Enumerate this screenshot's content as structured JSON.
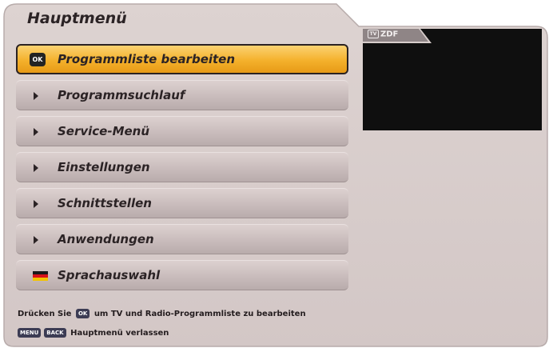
{
  "window": {
    "title": "Hauptmenü"
  },
  "menu": {
    "items": [
      {
        "label": "Programmliste bearbeiten",
        "icon": "ok-icon",
        "active": true
      },
      {
        "label": "Programmsuchlauf",
        "icon": "arrow-icon"
      },
      {
        "label": "Service-Menü",
        "icon": "arrow-icon"
      },
      {
        "label": "Einstellungen",
        "icon": "arrow-icon"
      },
      {
        "label": "Schnittstellen",
        "icon": "arrow-icon"
      },
      {
        "label": "Anwendungen",
        "icon": "arrow-icon"
      },
      {
        "label": "Sprachauswahl",
        "icon": "german-flag-icon"
      }
    ]
  },
  "ok_key_label": "OK",
  "preview": {
    "channel": "ZDF",
    "tv_icon": "TV"
  },
  "footer": {
    "hint_prefix": "Drücken Sie",
    "hint_suffix": "um TV und Radio-Programmliste zu bearbeiten",
    "menu_key": "MENU",
    "back_key": "BACK",
    "exit_label": "Hauptmenü verlassen"
  },
  "colors": {
    "panel": "#d5cac8",
    "highlight": "#f4b12c",
    "preview_bg": "#0f0f0f",
    "text": "#2b2325"
  }
}
